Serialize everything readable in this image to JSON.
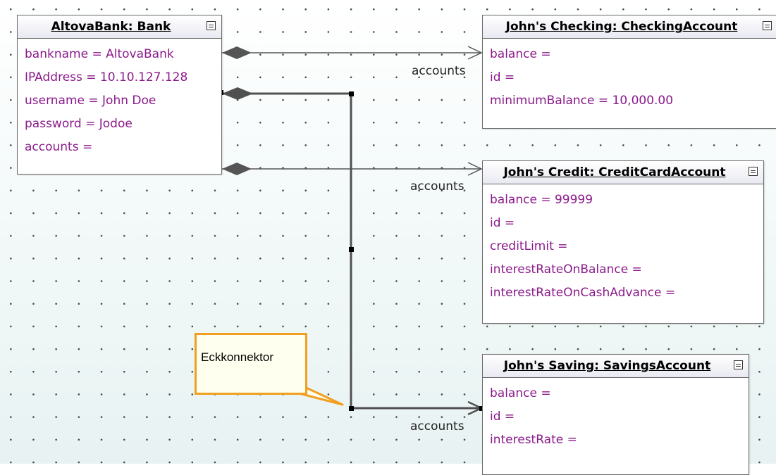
{
  "objects": {
    "bank": {
      "title": "AltovaBank: Bank",
      "slots": [
        "bankname =  AltovaBank",
        "IPAddress =  10.10.127.128",
        "username =  John Doe",
        "password =  Jodoe",
        "accounts ="
      ]
    },
    "checking": {
      "title": "John's Checking: CheckingAccount",
      "slots": [
        "balance =",
        "id =",
        "minimumBalance =  10,000.00"
      ]
    },
    "credit": {
      "title": "John's Credit: CreditCardAccount",
      "slots": [
        "balance =  99999",
        "id =",
        "creditLimit =",
        "interestRateOnBalance =",
        "interestRateOnCashAdvance ="
      ]
    },
    "saving": {
      "title": "John's Saving: SavingsAccount",
      "slots": [
        "balance =",
        "id =",
        "interestRate ="
      ]
    }
  },
  "links": {
    "role1": "accounts",
    "role2": "accounts",
    "role3": "accounts"
  },
  "note": {
    "text": "Eckkonnektor"
  },
  "colors": {
    "slot_text": "#8b1a8b",
    "note_border": "#f0a020",
    "note_fill": "#fffff0",
    "line": "#555555"
  }
}
